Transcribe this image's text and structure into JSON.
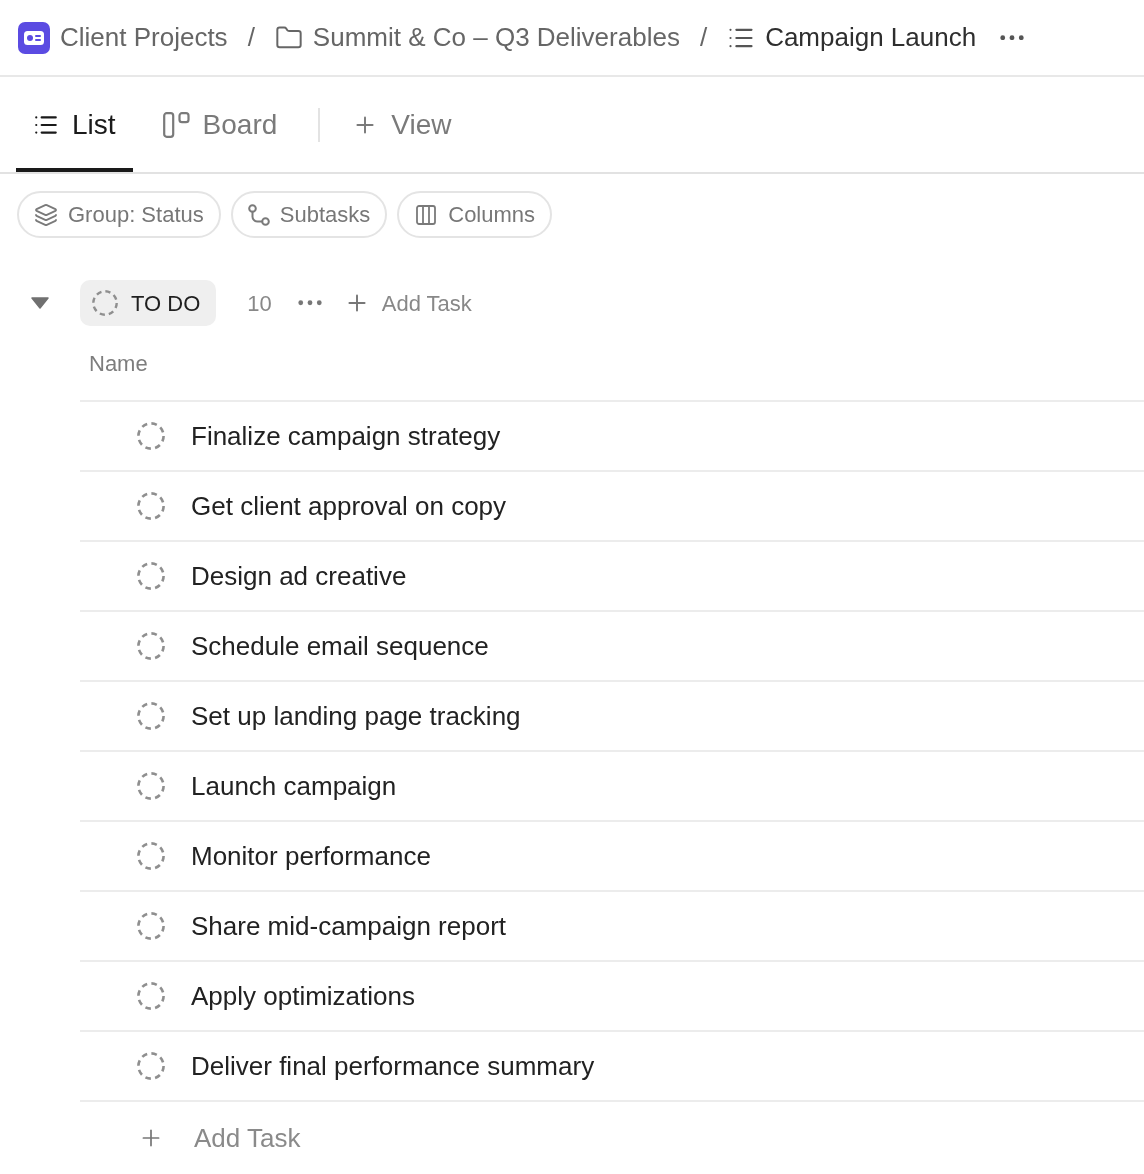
{
  "breadcrumb": {
    "items": [
      {
        "kind": "space",
        "label": "Client Projects",
        "current": false
      },
      {
        "kind": "folder",
        "label": "Summit & Co – Q3 Deliverables",
        "current": false
      },
      {
        "kind": "list",
        "label": "Campaign Launch",
        "current": true
      }
    ],
    "separators": [
      "/",
      "/"
    ]
  },
  "view_tabs": {
    "tabs": [
      {
        "kind": "list",
        "label": "List",
        "selected": true
      },
      {
        "kind": "board",
        "label": "Board",
        "selected": false
      }
    ],
    "add_view": "View"
  },
  "toolbar": [
    {
      "kind": "group",
      "label": "Group: Status"
    },
    {
      "kind": "subtasks",
      "label": "Subtasks"
    },
    {
      "kind": "columns",
      "label": "Columns"
    }
  ],
  "group": {
    "status": "TO DO",
    "expanded": true,
    "count": "10",
    "add_task": "Add Task",
    "columns": [
      "Name"
    ],
    "tasks": [
      {
        "name": "Finalize campaign strategy"
      },
      {
        "name": "Get client approval on copy"
      },
      {
        "name": "Design ad creative"
      },
      {
        "name": "Schedule email sequence"
      },
      {
        "name": "Set up landing page tracking"
      },
      {
        "name": "Launch campaign"
      },
      {
        "name": "Monitor performance"
      },
      {
        "name": "Share mid-campaign report"
      },
      {
        "name": "Apply optimizations"
      },
      {
        "name": "Deliver final performance summary"
      }
    ],
    "add_task_row": "Add Task"
  }
}
